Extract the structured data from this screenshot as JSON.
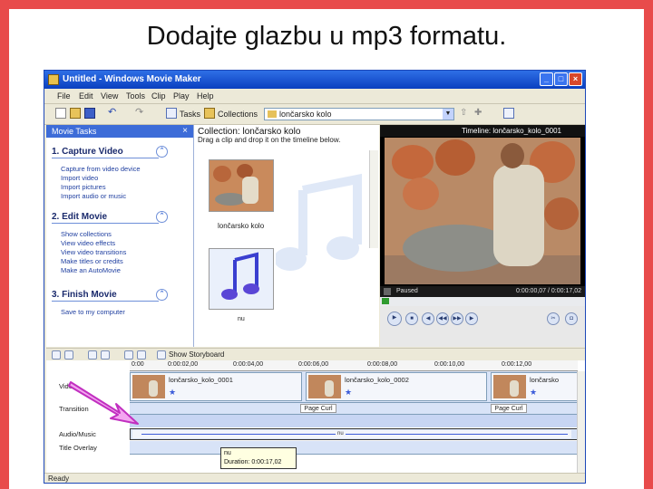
{
  "slide": {
    "title": "Dodajte glazbu u mp3 formatu."
  },
  "window": {
    "title": "Untitled - Windows Movie Maker",
    "controls": {
      "minimize": "_",
      "maximize": "□",
      "close": "×"
    }
  },
  "menu": [
    "File",
    "Edit",
    "View",
    "Tools",
    "Clip",
    "Play",
    "Help"
  ],
  "toolbar": {
    "tasks_label": "Tasks",
    "collections_label": "Collections",
    "collection_value": "lončarsko kolo"
  },
  "tasks_pane": {
    "header": "Movie Tasks",
    "close": "×",
    "sections": [
      {
        "title": "1. Capture Video",
        "items": [
          "Capture from video device",
          "Import video",
          "Import pictures",
          "Import audio or music"
        ]
      },
      {
        "title": "2. Edit Movie",
        "items": [
          "Show collections",
          "View video effects",
          "View video transitions",
          "Make titles or credits",
          "Make an AutoMovie"
        ]
      },
      {
        "title": "3. Finish Movie",
        "items": [
          "Save to my computer"
        ]
      }
    ]
  },
  "collection": {
    "title": "Collection: lončarsko kolo",
    "subtitle": "Drag a clip and drop it on the timeline below.",
    "clips": [
      {
        "label": "lončarsko kolo"
      },
      {
        "label": "nu"
      }
    ]
  },
  "monitor": {
    "title": "Timeline: lončarsko_kolo_0001",
    "status": "Paused",
    "time": "0:00:00,07 / 0:00:17,02"
  },
  "storyboard": {
    "toggle_label": "Show Storyboard"
  },
  "timeline": {
    "ruler": [
      "0:00",
      "0:00:02,00",
      "0:00:04,00",
      "0:00:06,00",
      "0:00:08,00",
      "0:00:10,00",
      "0:00:12,00"
    ],
    "tracks": [
      "Video",
      "Transition",
      "Audio/Music",
      "Title Overlay"
    ],
    "video_clips": [
      "lončarsko_kolo_0001",
      "lončarsko_kolo_0002",
      "lončarsko"
    ],
    "transitions": [
      "Page Curl",
      "Page Curl"
    ],
    "audio_clip": "nu",
    "tooltip": {
      "name": "nu",
      "duration": "Duration: 0:00:17,02"
    }
  },
  "statusbar": {
    "text": "Ready"
  },
  "colors": {
    "border": "#e84b4b",
    "titlebar": "#0a3fbf",
    "task_header": "#3d6cd8",
    "track": "#d8e3f7"
  }
}
